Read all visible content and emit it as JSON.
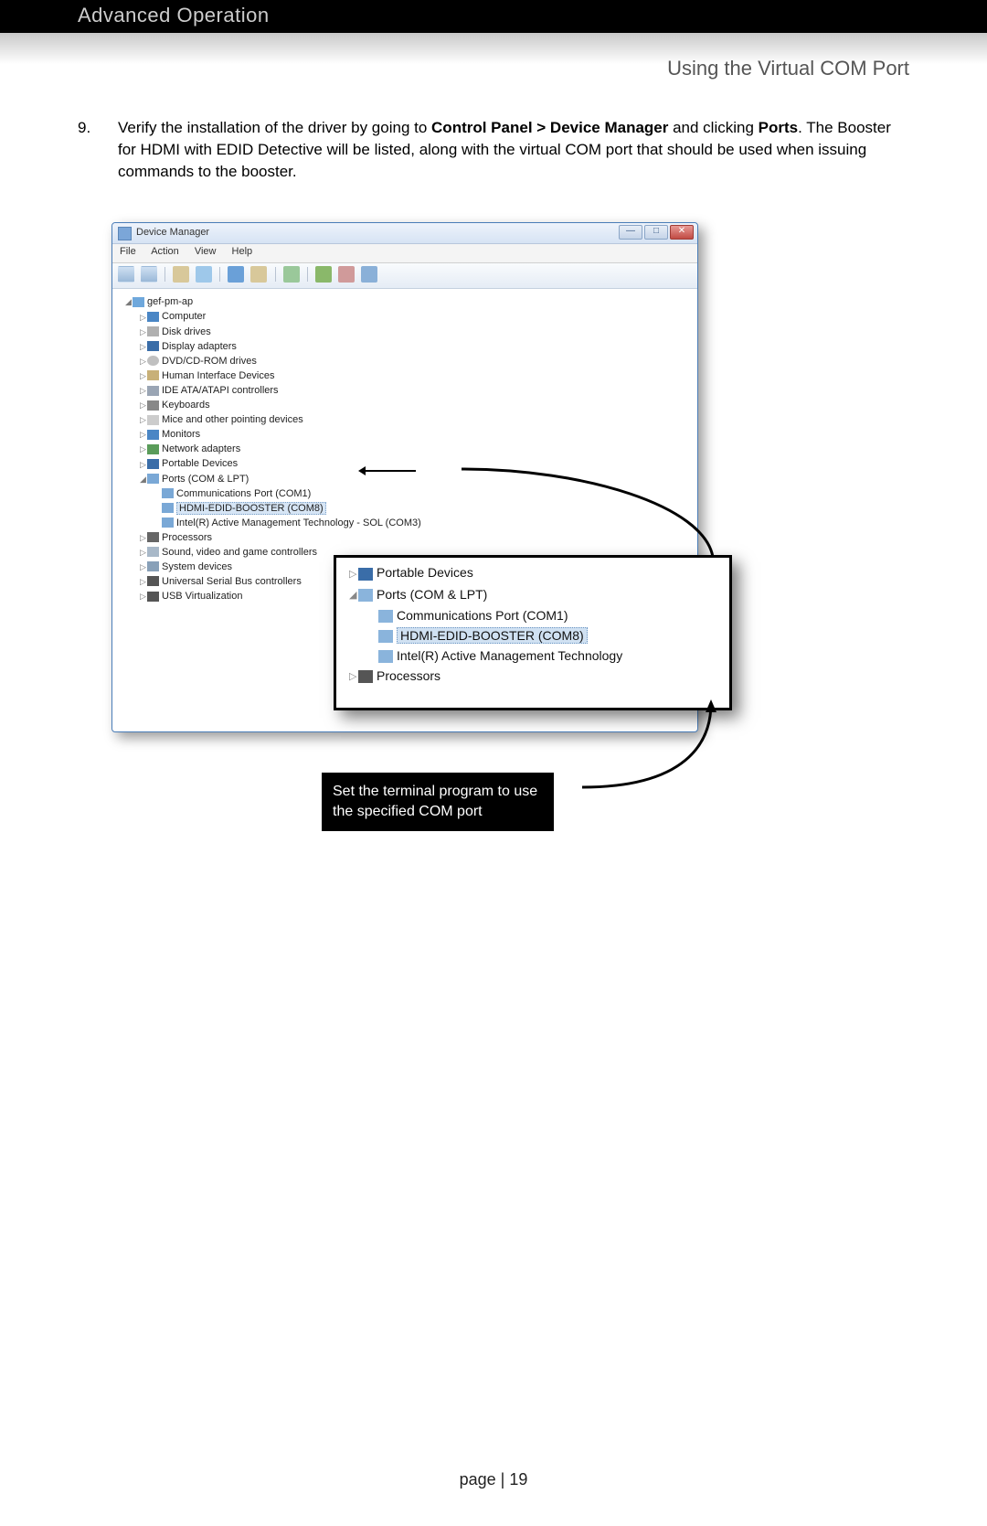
{
  "header": {
    "section": "Advanced Operation",
    "subtitle": "Using the Virtual COM Port"
  },
  "step": {
    "num": "9.",
    "pre": "Verify the installation of the driver by going to ",
    "b1": "Control Panel > Device Manager",
    "mid": " and clicking ",
    "b2": "Ports",
    "post": ".   The Booster for HDMI with EDID Detective will be listed, along with the virtual COM port that should be used when issuing commands to the booster."
  },
  "dm": {
    "title": "Device Manager",
    "menu": [
      "File",
      "Action",
      "View",
      "Help"
    ],
    "root": "gef-pm-ap",
    "nodes": [
      {
        "t": "Computer",
        "i": "ico-comp"
      },
      {
        "t": "Disk drives",
        "i": "ico-disk"
      },
      {
        "t": "Display adapters",
        "i": "ico-disp"
      },
      {
        "t": "DVD/CD-ROM drives",
        "i": "ico-dvd"
      },
      {
        "t": "Human Interface Devices",
        "i": "ico-hid"
      },
      {
        "t": "IDE ATA/ATAPI controllers",
        "i": "ico-ide"
      },
      {
        "t": "Keyboards",
        "i": "ico-kbd"
      },
      {
        "t": "Mice and other pointing devices",
        "i": "ico-mouse"
      },
      {
        "t": "Monitors",
        "i": "ico-mon"
      },
      {
        "t": "Network adapters",
        "i": "ico-net"
      },
      {
        "t": "Portable Devices",
        "i": "ico-pd"
      }
    ],
    "ports": {
      "label": "Ports (COM & LPT)",
      "children": [
        "Communications Port (COM1)",
        "HDMI-EDID-BOOSTER (COM8)",
        "Intel(R) Active Management Technology - SOL (COM3)"
      ]
    },
    "tail": [
      {
        "t": "Processors",
        "i": "ico-proc"
      },
      {
        "t": "Sound, video and game controllers",
        "i": "ico-snd"
      },
      {
        "t": "System devices",
        "i": "ico-sys"
      },
      {
        "t": "Universal Serial Bus controllers",
        "i": "ico-usb"
      },
      {
        "t": "USB Virtualization",
        "i": "ico-usb"
      }
    ]
  },
  "zoom": {
    "items": [
      {
        "t": "Portable Devices",
        "lvl": 0,
        "exp": "▷",
        "i": "zpd"
      },
      {
        "t": "Ports (COM & LPT)",
        "lvl": 0,
        "exp": "◢",
        "i": "zport"
      },
      {
        "t": "Communications Port (COM1)",
        "lvl": 1,
        "exp": "",
        "i": "zport"
      },
      {
        "t": "HDMI-EDID-BOOSTER (COM8)",
        "lvl": 1,
        "exp": "",
        "i": "zport",
        "sel": true
      },
      {
        "t": "Intel(R) Active Management Technology",
        "lvl": 1,
        "exp": "",
        "i": "zport"
      },
      {
        "t": "Processors",
        "lvl": 0,
        "exp": "▷",
        "i": "zproc"
      }
    ]
  },
  "callout": "Set the terminal program to use the specified COM port",
  "footer": {
    "label": "page | ",
    "num": "19"
  }
}
